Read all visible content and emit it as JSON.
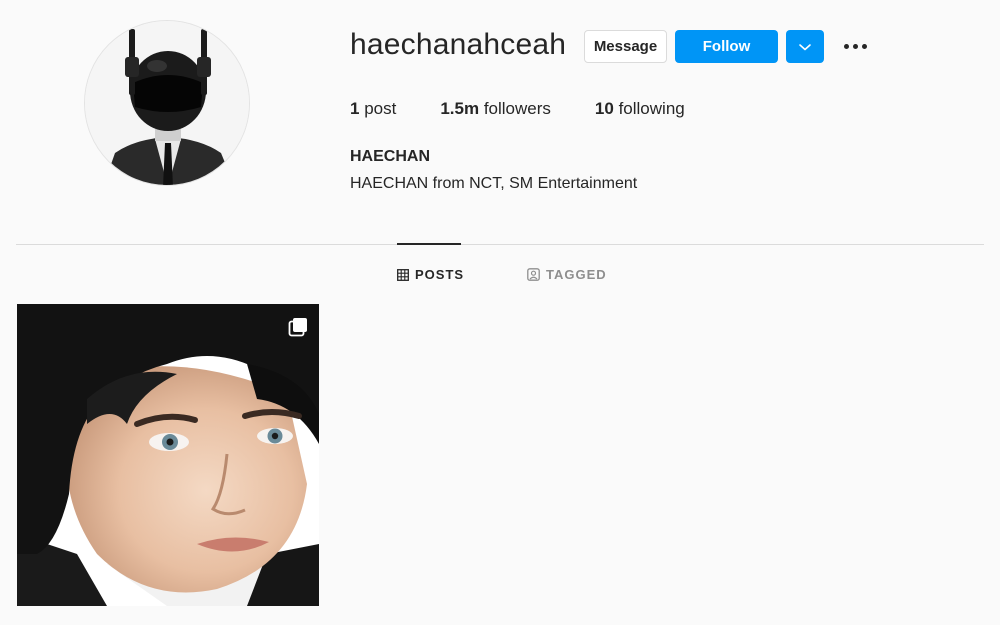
{
  "profile": {
    "username": "haechanahceah",
    "full_name": "HAECHAN",
    "bio": "HAECHAN from NCT, SM Entertainment"
  },
  "actions": {
    "message_label": "Message",
    "follow_label": "Follow",
    "dropdown_icon": "chevron-down-icon",
    "more_icon": "more-horizontal-icon"
  },
  "stats": {
    "posts": {
      "count": "1",
      "label": "post"
    },
    "followers": {
      "count": "1.5m",
      "label": "followers"
    },
    "following": {
      "count": "10",
      "label": "following"
    }
  },
  "tabs": [
    {
      "label": "POSTS",
      "icon": "grid-icon",
      "active": true
    },
    {
      "label": "TAGGED",
      "icon": "tagged-icon",
      "active": false
    }
  ],
  "colors": {
    "accent": "#0095f6",
    "background": "#fafafa",
    "text": "#262626",
    "muted": "#8e8e8e"
  },
  "posts": [
    {
      "type": "carousel",
      "icon": "carousel-icon"
    }
  ]
}
